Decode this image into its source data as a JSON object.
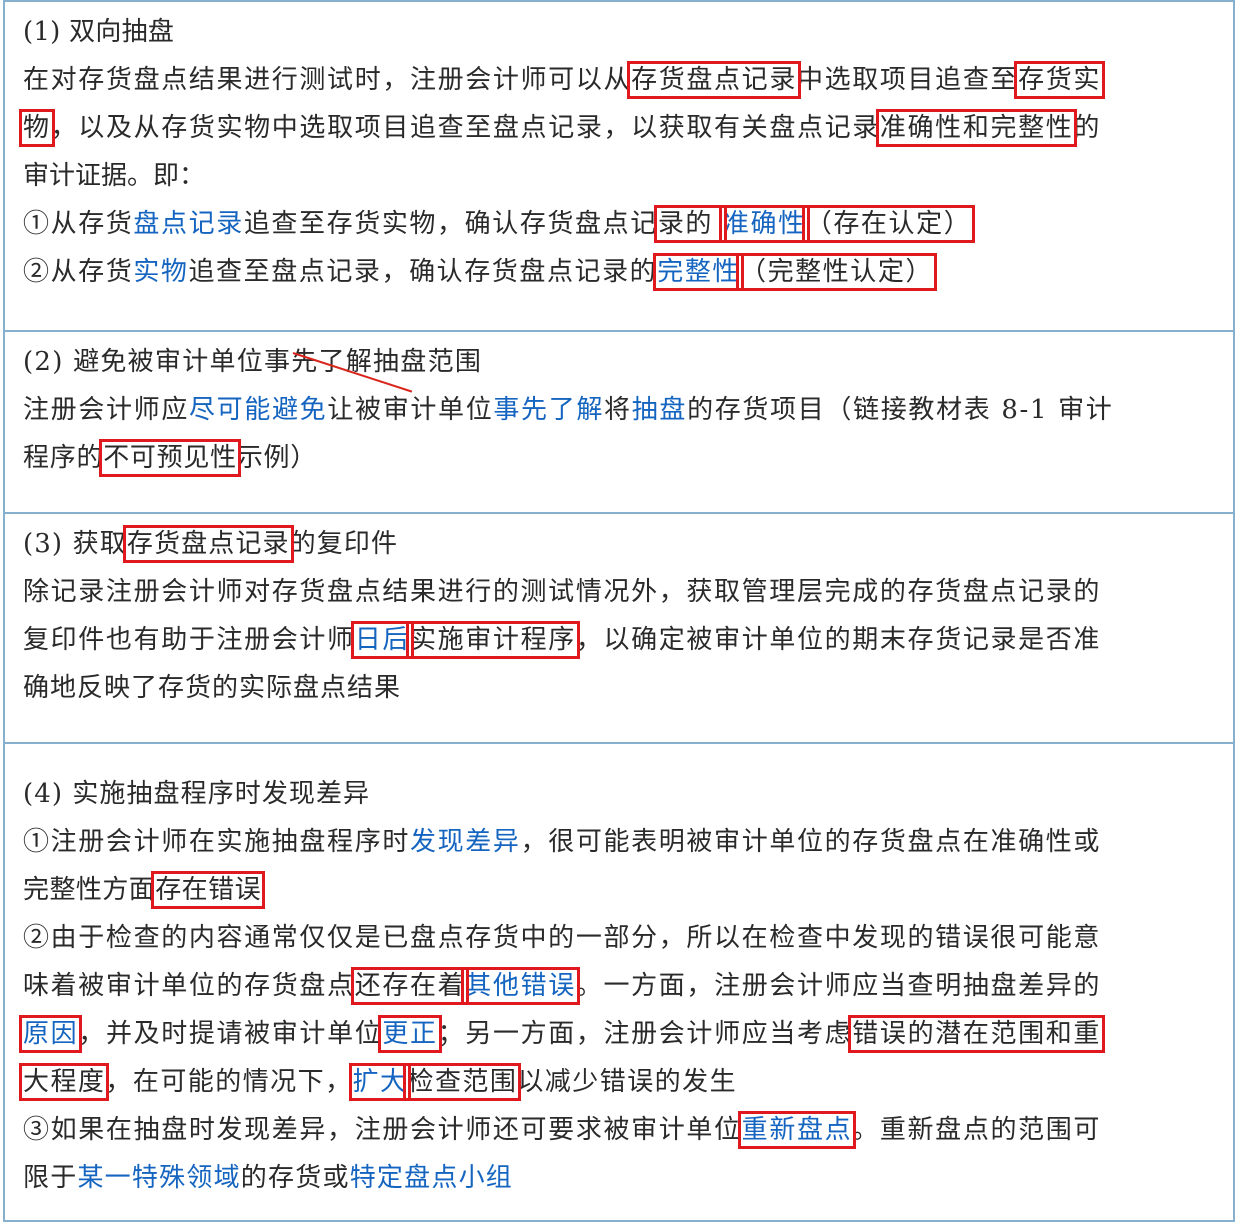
{
  "sections": [
    {
      "lines": [
        [
          {
            "t": "(1) 双向抽盘"
          }
        ],
        [
          {
            "t": "在对存货盘点结果进行测试时，注册会计师可以从"
          },
          {
            "t": "存货盘点记录",
            "box": true
          },
          {
            "t": "中选取项目追查至"
          },
          {
            "t": "存货实",
            "box": true
          }
        ],
        [
          {
            "t": "物",
            "box": true
          },
          {
            "t": "，以及从存货实物中选取项目追查至盘点记录，以获取有关盘点记录"
          },
          {
            "t": "准确性和完整性",
            "box": true
          },
          {
            "t": "的"
          }
        ],
        [
          {
            "t": "审计证据。即："
          }
        ],
        [
          {
            "t": "①从存货"
          },
          {
            "t": "盘点记录",
            "blue": true
          },
          {
            "t": "追查至存货实物，确认存货盘点记"
          },
          {
            "t": "录的 ",
            "box": true
          },
          {
            "t": "准确性",
            "blue": true,
            "box": true
          },
          {
            "t": "（存在认定）",
            "box": true
          }
        ],
        [
          {
            "t": "②从存货"
          },
          {
            "t": "实物",
            "blue": true
          },
          {
            "t": "追查至盘点记录，确认存货盘点记录的"
          },
          {
            "t": "完整性",
            "blue": true,
            "box": true
          },
          {
            "t": "（完整性认定）",
            "box": true
          }
        ]
      ]
    },
    {
      "lines": [
        [
          {
            "t": "(2) 避免被审计单位事先了解抽盘范围"
          }
        ],
        [
          {
            "t": "注册会计师应"
          },
          {
            "t": "尽可能避免",
            "blue": true
          },
          {
            "t": "让被审计单位"
          },
          {
            "t": "事先了解",
            "blue": true
          },
          {
            "t": "将"
          },
          {
            "t": "抽盘",
            "blue": true
          },
          {
            "t": "的存货项目（链接教材表 8-1 审计"
          }
        ],
        [
          {
            "t": "程序的"
          },
          {
            "t": "不可预见性",
            "box": true
          },
          {
            "t": "示例）"
          }
        ]
      ]
    },
    {
      "lines": [
        [
          {
            "t": "(3) 获取"
          },
          {
            "t": "存货盘点记录",
            "box": true
          },
          {
            "t": "的复印件"
          }
        ],
        [
          {
            "t": "除记录注册会计师对存货盘点结果进行的测试情况外，获取管理层完成的存货盘点记录的"
          }
        ],
        [
          {
            "t": "复印件也有助于注册会计师"
          },
          {
            "t": "日后",
            "blue": true,
            "box": true
          },
          {
            "t": "实施审计程序",
            "box": true
          },
          {
            "t": "，以确定被审计单位的期末存货记录是否准"
          }
        ],
        [
          {
            "t": "确地反映了存货的实际盘点结果"
          }
        ]
      ]
    },
    {
      "lines": [
        [
          {
            "t": "(4) 实施抽盘程序时发现差异"
          }
        ],
        [
          {
            "t": "①注册会计师在实施抽盘程序时"
          },
          {
            "t": "发现差异",
            "blue": true
          },
          {
            "t": "，很可能表明被审计单位的存货盘点在准确性或"
          }
        ],
        [
          {
            "t": "完整性方面"
          },
          {
            "t": "存在错误",
            "box": true
          }
        ],
        [
          {
            "t": "②由于检查的内容通常仅仅是已盘点存货中的一部分，所以在检查中发现的错误很可能意"
          }
        ],
        [
          {
            "t": "味着被审计单位的存货盘点"
          },
          {
            "t": "还存在着",
            "box": true
          },
          {
            "t": "其他错误",
            "blue": true,
            "box": true
          },
          {
            "t": "。一方面，注册会计师应当查明抽盘差异的"
          }
        ],
        [
          {
            "t": "原因",
            "blue": true,
            "box": true
          },
          {
            "t": "，并及时提请被审计单位"
          },
          {
            "t": "更正",
            "blue": true,
            "box": true
          },
          {
            "t": "；另一方面，注册会计师应当考虑"
          },
          {
            "t": "错误的潜在范围和重",
            "box": true
          }
        ],
        [
          {
            "t": "大程度",
            "box": true
          },
          {
            "t": "，在可能的情况下，"
          },
          {
            "t": "扩大",
            "blue": true,
            "box": true
          },
          {
            "t": "检查范围",
            "box": true
          },
          {
            "t": "以减少错误的发生"
          }
        ],
        [
          {
            "t": "③如果在抽盘时发现差异，注册会计师还可要求被审计单位"
          },
          {
            "t": "重新盘点",
            "blue": true,
            "box": true
          },
          {
            "t": "。重新盘点的范围可"
          }
        ],
        [
          {
            "t": "限于"
          },
          {
            "t": "某一特殊领域",
            "blue": true
          },
          {
            "t": "的存货或"
          },
          {
            "t": "特定盘点小组",
            "blue": true
          }
        ]
      ]
    }
  ]
}
